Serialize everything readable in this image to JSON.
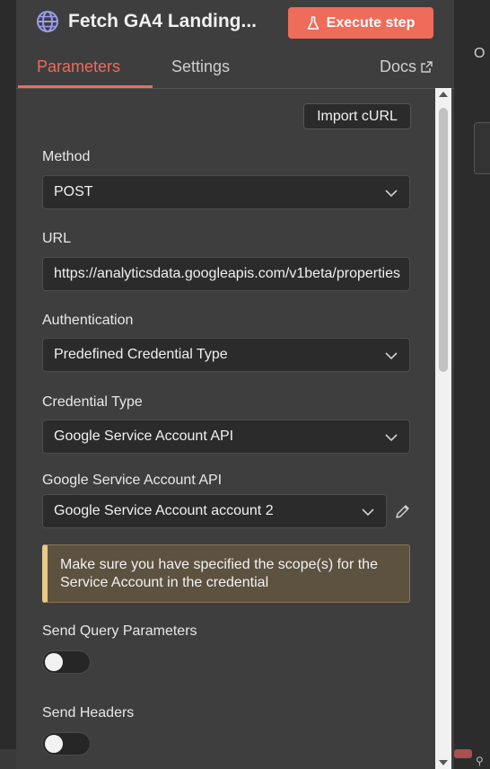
{
  "node": {
    "title": "Fetch GA4 Landing...",
    "execute_label": "Execute step",
    "icon": "globe-icon"
  },
  "tabs": {
    "parameters": "Parameters",
    "settings": "Settings",
    "docs": "Docs"
  },
  "import_curl_label": "Import cURL",
  "method": {
    "label": "Method",
    "value": "POST"
  },
  "url": {
    "label": "URL",
    "value": "https://analyticsdata.googleapis.com/v1beta/properties"
  },
  "authentication": {
    "label": "Authentication",
    "value": "Predefined Credential Type"
  },
  "credential_type": {
    "label": "Credential Type",
    "value": "Google Service Account API"
  },
  "google_service_account": {
    "label": "Google Service Account API",
    "value": "Google Service Account account 2"
  },
  "notice": {
    "text": "Make sure you have specified the scope(s) for the Service Account in the credential"
  },
  "send_query_parameters": {
    "label": "Send Query Parameters",
    "enabled": false
  },
  "send_headers": {
    "label": "Send Headers",
    "enabled": false
  },
  "background": {
    "right_letter": "O"
  },
  "colors": {
    "accent": "#ef6b5a",
    "panel": "#3e3e3e",
    "field": "#2b2b2b",
    "notice_bg": "#5d5240",
    "notice_border": "#e7c98a"
  }
}
